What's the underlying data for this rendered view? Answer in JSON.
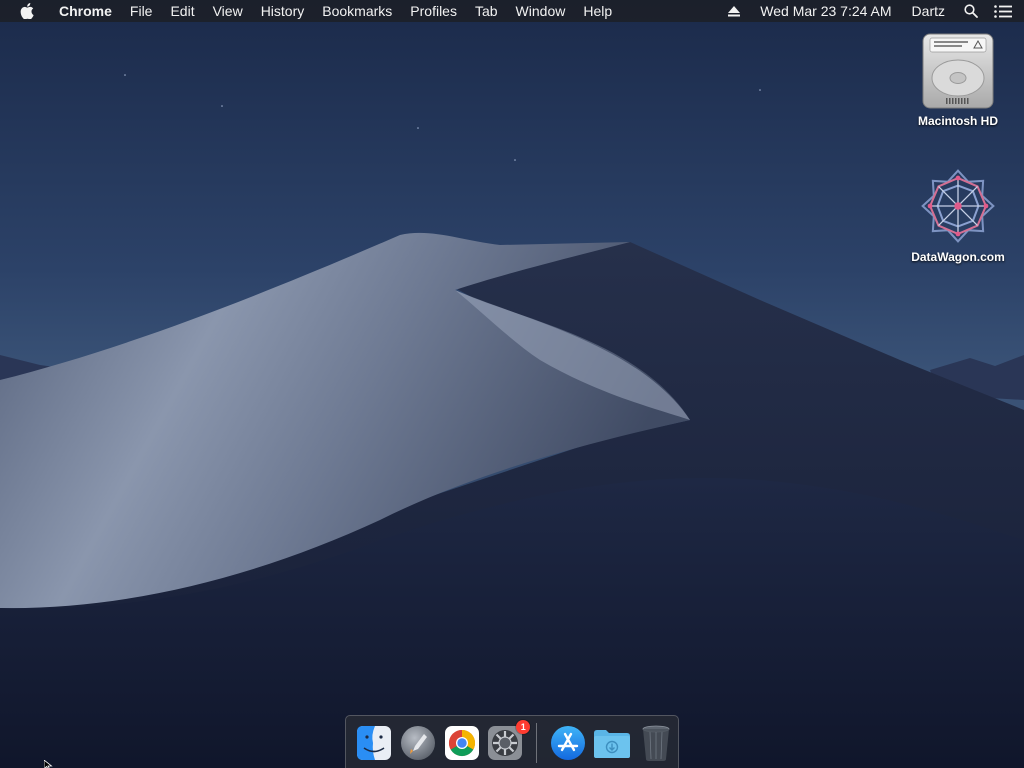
{
  "menubar": {
    "app_name": "Chrome",
    "menus": [
      "File",
      "Edit",
      "View",
      "History",
      "Bookmarks",
      "Profiles",
      "Tab",
      "Window",
      "Help"
    ],
    "datetime": "Wed Mar 23  7:24 AM",
    "user": "Dartz",
    "icons": [
      "apple-icon",
      "eject-icon",
      "spotlight-search-icon",
      "notification-center-icon"
    ]
  },
  "desktop": {
    "icons": [
      {
        "label": "Macintosh HD",
        "icon": "hard-drive-icon"
      },
      {
        "label": "DataWagon.com",
        "icon": "datawagon-logo-icon"
      }
    ]
  },
  "dock": {
    "apps": [
      {
        "name": "Finder",
        "icon": "finder-icon",
        "running": true
      },
      {
        "name": "Launchpad",
        "icon": "launchpad-icon",
        "running": false
      },
      {
        "name": "Google Chrome",
        "icon": "chrome-icon",
        "running": true
      },
      {
        "name": "System Preferences",
        "icon": "system-preferences-icon",
        "running": false,
        "badge": "1"
      }
    ],
    "others": [
      {
        "name": "App Store",
        "icon": "app-store-icon"
      },
      {
        "name": "Downloads",
        "icon": "downloads-folder-icon"
      },
      {
        "name": "Trash",
        "icon": "trash-icon"
      }
    ]
  },
  "colors": {
    "menubar_bg": "#1c1e24",
    "sky_top": "#1d2c4c",
    "dune_light": "#8d9bb3",
    "badge": "#ff3b30"
  }
}
